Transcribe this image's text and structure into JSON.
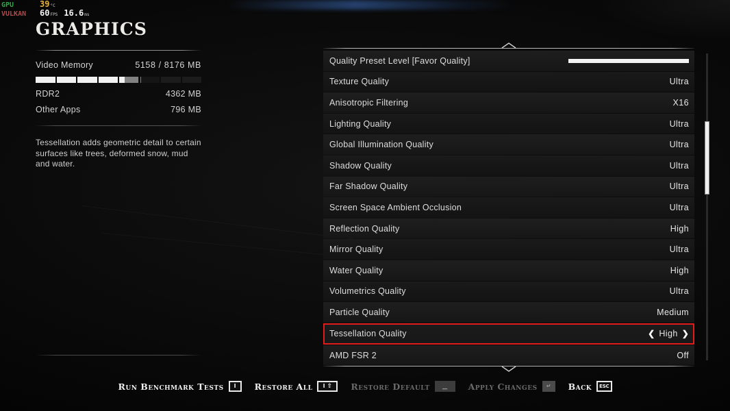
{
  "overlay": {
    "gpu_label": "GPU",
    "api_label": "VULKAN",
    "temperature": "39",
    "temperature_unit": "°C",
    "fps": "60",
    "fps_unit": "FPS",
    "frametime": "16.6",
    "frametime_unit": "ms"
  },
  "left_panel": {
    "title": "GRAPHICS",
    "video_memory_label": "Video Memory",
    "video_memory_value": "5158 / 8176 MB",
    "video_memory_used_mb": 5158,
    "video_memory_total_mb": 8176,
    "breakdown": [
      {
        "label": "RDR2",
        "value": "4362 MB",
        "mb": 4362
      },
      {
        "label": "Other Apps",
        "value": "796 MB",
        "mb": 796
      }
    ],
    "description": "Tessellation adds geometric detail to certain surfaces like trees, deformed snow, mud and water."
  },
  "settings": {
    "scroll_up_icon": "chevron-up-icon",
    "scroll_down_icon": "chevron-down-icon",
    "rows": [
      {
        "label": "Quality Preset Level [Favor Quality]",
        "value": "",
        "type": "slider",
        "slider_percent": 100
      },
      {
        "label": "Texture Quality",
        "value": "Ultra",
        "type": "value"
      },
      {
        "label": "Anisotropic Filtering",
        "value": "X16",
        "type": "value"
      },
      {
        "label": "Lighting Quality",
        "value": "Ultra",
        "type": "value"
      },
      {
        "label": "Global Illumination Quality",
        "value": "Ultra",
        "type": "value"
      },
      {
        "label": "Shadow Quality",
        "value": "Ultra",
        "type": "value"
      },
      {
        "label": "Far Shadow Quality",
        "value": "Ultra",
        "type": "value"
      },
      {
        "label": "Screen Space Ambient Occlusion",
        "value": "Ultra",
        "type": "value"
      },
      {
        "label": "Reflection Quality",
        "value": "High",
        "type": "value"
      },
      {
        "label": "Mirror Quality",
        "value": "Ultra",
        "type": "value"
      },
      {
        "label": "Water Quality",
        "value": "High",
        "type": "value"
      },
      {
        "label": "Volumetrics Quality",
        "value": "Ultra",
        "type": "value"
      },
      {
        "label": "Particle Quality",
        "value": "Medium",
        "type": "value"
      },
      {
        "label": "Tessellation Quality",
        "value": "High",
        "type": "selector",
        "selected": true,
        "prev_icon": "chevron-left-icon",
        "next_icon": "chevron-right-icon"
      },
      {
        "label": "AMD FSR 2",
        "value": "Off",
        "type": "value"
      }
    ],
    "selection_color": "#e21b1b",
    "scrollbar": {
      "thumb_top_percent": 22,
      "thumb_height_percent": 24
    }
  },
  "bottom_bar": {
    "actions": [
      {
        "label": "Run Benchmark Tests",
        "key": "I",
        "enabled": true,
        "key_style": "letter"
      },
      {
        "label": "Restore All",
        "key": "I",
        "key_modifier": "⇧",
        "enabled": true,
        "key_style": "combo"
      },
      {
        "label": "Restore Default",
        "key": "",
        "enabled": false,
        "key_style": "blank"
      },
      {
        "label": "Apply Changes",
        "key": "↵",
        "enabled": false,
        "key_style": "enter"
      },
      {
        "label": "Back",
        "key": "ESC",
        "enabled": true,
        "key_style": "esc"
      }
    ]
  }
}
